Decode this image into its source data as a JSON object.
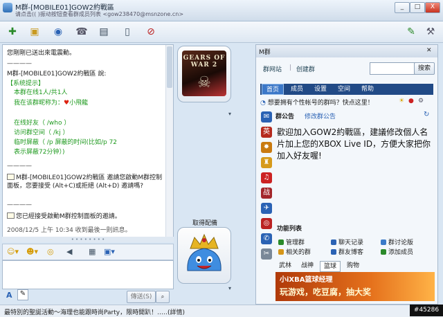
{
  "window": {
    "title": "M群-[MOBILE01]GOW2約戰區",
    "subtitle": "请点击(( )振动按钮查看群成员列表 <gow238470@msnzone.cn>",
    "buttons": [
      "_",
      "□",
      "X"
    ]
  },
  "toolbar": {
    "icons": [
      "add-contact-icon",
      "folder-icon",
      "share-icon",
      "phone-icon",
      "video-icon",
      "mobile-icon",
      "block-icon",
      "pen-icon",
      "tools-icon"
    ]
  },
  "chat": {
    "intro": "您剛剛已送出來電震動。",
    "sep1": "————",
    "group_said": "M群-[MOBILE01]GOW2約戰區 說:",
    "system_tip": "【系统提示】",
    "online": "本群在线1人/共1人",
    "nickname_prefix": "我在该群昵称为：",
    "heart": "♥",
    "nickname": "小飛龍",
    "friends": "在线好友（ /who ）",
    "space": "访问群空间（ /kj ）",
    "block": "临时屏蔽（ /p 屏蔽的时间(比如/p 72",
    "block2": "表示屏蔽72分钟）)",
    "sep2": "————",
    "invite": "M群-[MOBILE01]GOW2約戰區 邀請您啟動M群控制面板，您要接受 (Alt+C)或拒絕 (Alt+D) 邀請嗎?",
    "sep3": "————",
    "accepted": "您已經接受啟動M群控制面板的邀請。",
    "last_received": "2008/12/5 上午 10:34 收到最後一則訊息。"
  },
  "input": {
    "send_label": "傳送(S)",
    "font_label": "A"
  },
  "status_bar": {
    "text": "最特別的聖誕活動～海理也能跟時尚Party，限時開趴！‥‥.(詳情)",
    "watermark": "#45286"
  },
  "avatars": {
    "top_game_title": "GEARS OF WAR 2",
    "bottom_label": "取得配備"
  },
  "group_panel": {
    "title": "M群",
    "close": "✕",
    "nav": [
      "群网站",
      "创建群"
    ],
    "search_value": "",
    "search_label": "搜索",
    "tabs": [
      "首页",
      "成员",
      "设置",
      "空间",
      "帮助"
    ],
    "question": "想要拥有个性帐号的群吗？快点这里！",
    "notice_head": "群公告",
    "notice_edit": "修改群公告",
    "notice_body": "歡迎加入GOW2約戰區，建議修改個人名片加上您的XBOX Live ID，方便大家把你加入好友喔!",
    "functions_title": "功能列表",
    "functions": [
      "管理群",
      "聊天记录",
      "群讨论版",
      "相关的群",
      "群友博客",
      "添加成员"
    ],
    "bottom_tabs": [
      "武林",
      "战神",
      "篮球",
      "购物"
    ],
    "ad_title": "小iXBA篮球经理",
    "ad_line": "玩游戏，吃豆腐，抽大奖"
  },
  "colors": {
    "accent": "#214a86",
    "green_text": "#1f9a1f",
    "ad_orange": "#e5711c"
  }
}
